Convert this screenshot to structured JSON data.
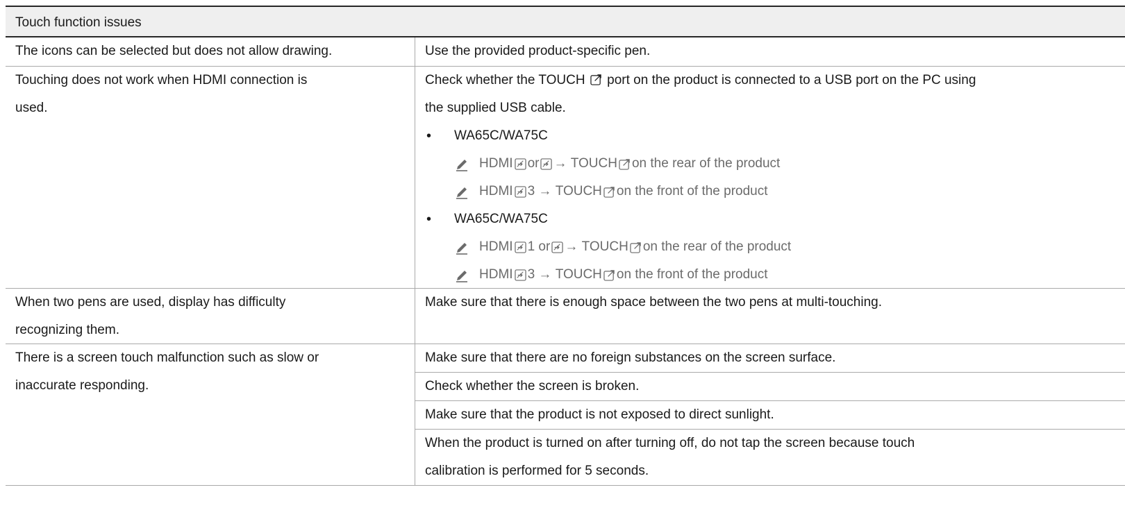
{
  "section_title": "Touch function issues",
  "rows": [
    {
      "issue": "The icons can be selected but does not allow drawing.",
      "solution": "Use the provided product-specific pen."
    },
    {
      "issue_line1": "Touching does not work when HDMI connection is",
      "issue_line2": "used.",
      "solution_pre": "Check whether the",
      "solution_kw": "TOUCH",
      "solution_post": "port on the product is connected to a USB port on the PC using",
      "solution_line2": "the supplied USB cable.",
      "groups": [
        {
          "model": "WA65C/WA75C",
          "notes": [
            {
              "hdmi": "HDMI",
              "num1": "",
              "mid": "or",
              "arrow": "→",
              "touch": "TOUCH",
              "tail": "on the rear of the product"
            },
            {
              "hdmi": "HDMI",
              "num1": "3",
              "arrow": "→",
              "touch": "TOUCH",
              "tail": "on the front of the product"
            }
          ]
        },
        {
          "model": "WA65C/WA75C",
          "notes": [
            {
              "hdmi": "HDMI",
              "num1": "1",
              "mid": "or",
              "arrow": "→",
              "touch": "TOUCH",
              "tail": "on the rear of the product"
            },
            {
              "hdmi": "HDMI",
              "num1": "3",
              "arrow": "→",
              "touch": "TOUCH",
              "tail": "on the front of the product"
            }
          ]
        }
      ]
    },
    {
      "issue_line1": "When two pens are used, display has difficulty",
      "issue_line2": "recognizing them.",
      "solution": "Make sure that there is enough space between the two pens at multi-touching."
    },
    {
      "issue_line1": "There is a screen touch malfunction such as slow or",
      "issue_line2": "inaccurate responding.",
      "solutions": [
        "Make sure that there are no foreign substances on the screen surface.",
        "Check whether the screen is broken.",
        "Make sure that the product is not exposed to direct sunlight."
      ],
      "last_solution_line1": "When the product is turned on after turning off, do not tap the screen because touch",
      "last_solution_line2": "calibration is performed for 5 seconds."
    }
  ],
  "icons": {
    "pencil": "pencil-icon",
    "port_in": "input-port-icon",
    "port_out": "output-port-icon"
  }
}
